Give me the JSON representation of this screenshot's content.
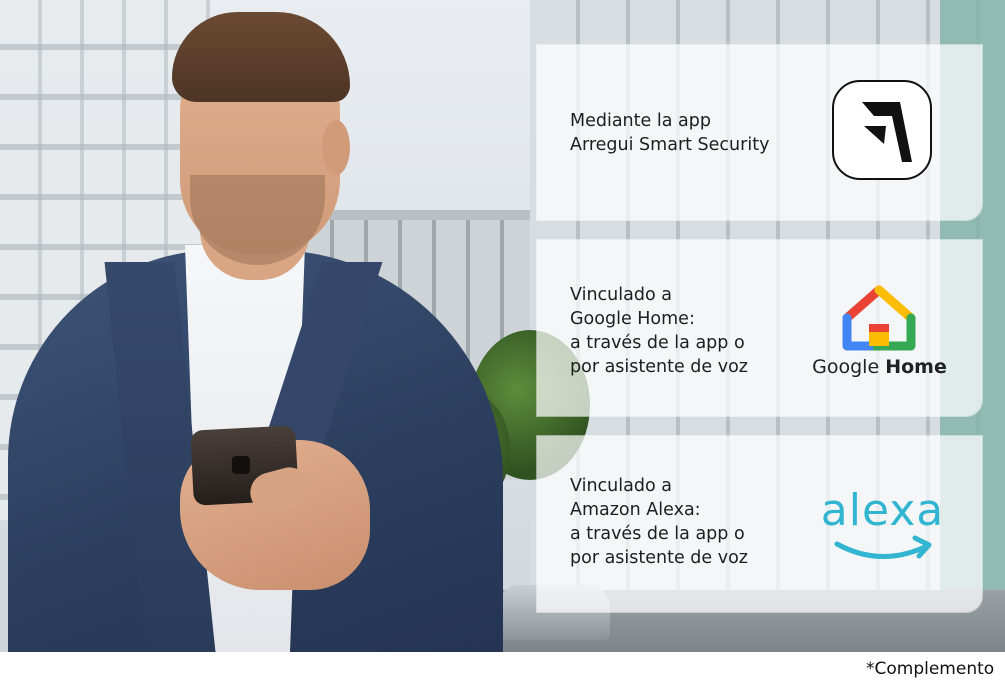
{
  "cards": [
    {
      "lines": [
        "Mediante la app",
        "Arregui Smart Security"
      ],
      "logo": "arregui-logo"
    },
    {
      "lines": [
        "Vinculado a",
        "Google Home:",
        "a través de la app o",
        "por asistente de voz"
      ],
      "logo": "google-home-logo",
      "logo_label_regular": "Google",
      "logo_label_bold": "Home"
    },
    {
      "lines": [
        "Vinculado a",
        "Amazon Alexa:",
        "a través de la app o",
        "por asistente de voz"
      ],
      "logo": "alexa-logo",
      "logo_label": "alexa"
    }
  ],
  "footnote": "*Complemento",
  "colors": {
    "alexa_blue": "#31b5d1",
    "google_red": "#ea4335",
    "google_yellow": "#fbbc04",
    "google_green": "#34a853",
    "google_blue": "#4285f4",
    "card_bg": "rgba(255,255,255,0.72)"
  }
}
